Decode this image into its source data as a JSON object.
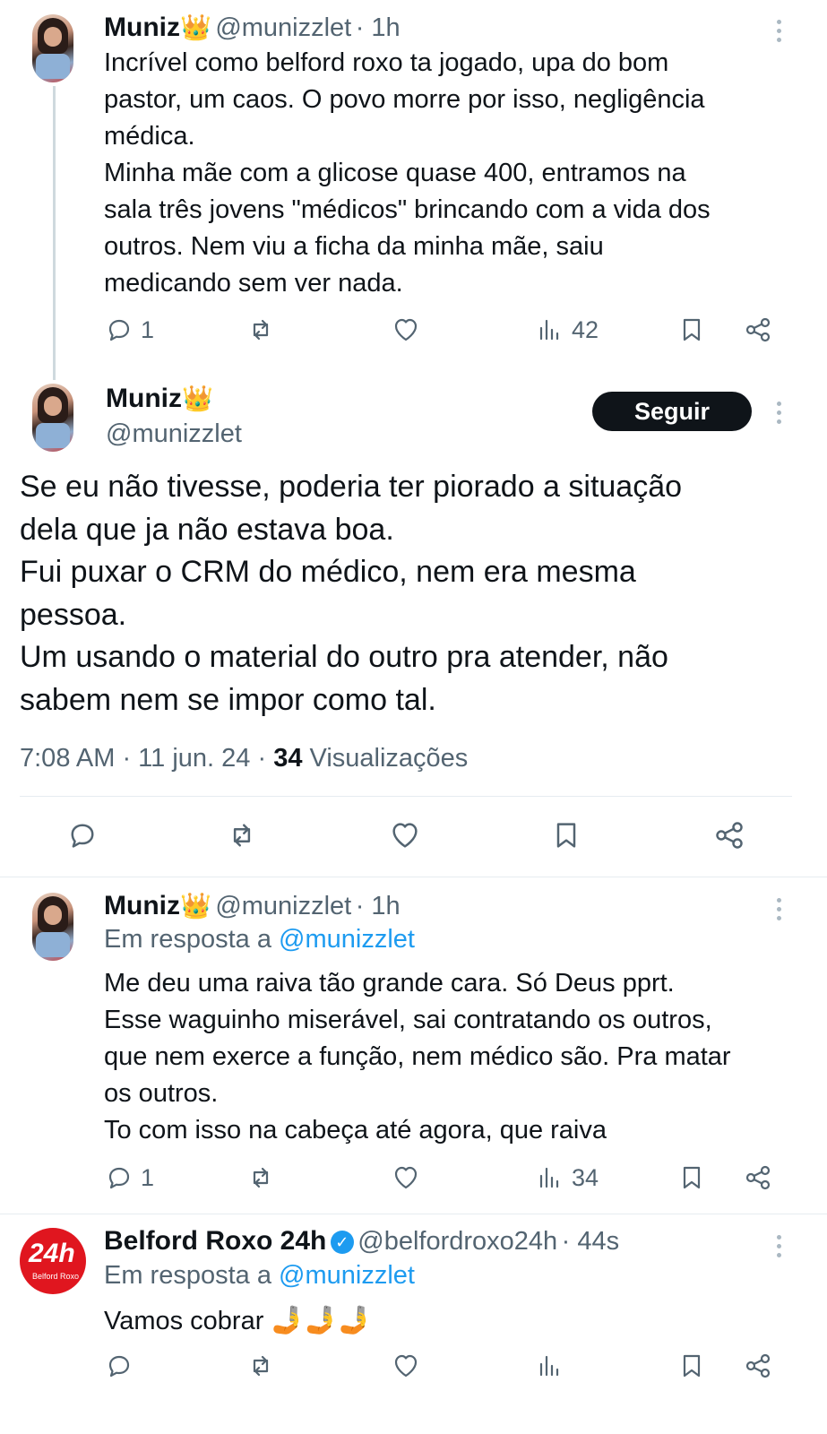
{
  "tweet1": {
    "name": "Muniz",
    "crown": "👑",
    "handle": "@munizzlet",
    "time": "· 1h",
    "text": "Incrível como belford roxo ta jogado, upa do bom\npastor, um caos. O povo morre por isso, negligência\nmédica.\nMinha mãe com a glicose quase 400, entramos na\nsala três jovens \"médicos\" brincando com a vida dos\noutros. Nem viu a ficha da minha mãe, saiu\nmedicando sem ver nada.",
    "replies": "1",
    "views": "42"
  },
  "tweet2": {
    "name": "Muniz",
    "crown": "👑",
    "handle": "@munizzlet",
    "follow_label": "Seguir",
    "text": "Se eu não tivesse, poderia ter piorado a situação\ndela que ja não estava boa.\nFui puxar o CRM do médico, nem era mesma\npessoa.\nUm usando o material do outro pra atender, não\nsabem nem se impor como tal.",
    "timestamp": "7:08 AM · 11 jun. 24 · ",
    "views_count": "34",
    "views_label": " Visualizações"
  },
  "tweet3": {
    "name": "Muniz",
    "crown": "👑",
    "handle": "@munizzlet",
    "time": "· 1h",
    "reply_prefix": "Em resposta a ",
    "reply_to": "@munizzlet",
    "text": "Me deu uma raiva tão grande cara. Só Deus pprt.\nEsse waguinho miserável, sai contratando os outros,\nque nem exerce a função, nem médico são. Pra matar\nos outros.\nTo com isso na cabeça até agora, que raiva",
    "replies": "1",
    "views": "34"
  },
  "tweet4": {
    "name": "Belford Roxo 24h",
    "handle": "@belfordroxo24h",
    "time": "· 44s",
    "reply_prefix": "Em resposta a ",
    "reply_to": "@munizzlet",
    "text": "Vamos cobrar ",
    "emoji": "🤳🤳🤳",
    "avatar_big": "24h",
    "avatar_small": "Belford Roxo"
  },
  "colors": {
    "text": "#0f1419",
    "muted": "#536471",
    "link": "#1d9bf0",
    "badge": "#e0161f"
  }
}
